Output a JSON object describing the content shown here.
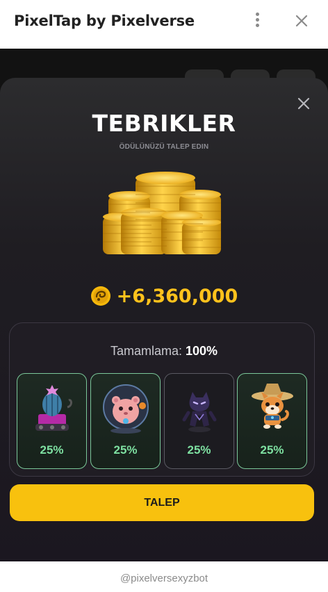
{
  "window": {
    "title": "PixelTap by Pixelverse",
    "icons": [
      "more-vertical-icon",
      "close-icon"
    ]
  },
  "modal": {
    "title": "TEBRIKLER",
    "subtitle": "ÖDÜLÜNÜZÜ TALEP EDIN",
    "reward": {
      "icon": "pixel-coin-icon",
      "amount": "+6,360,000"
    },
    "progress": {
      "label": "Tamamlama:",
      "value": "100%"
    },
    "cards": [
      {
        "name": "cactus-pet",
        "percent": "25%"
      },
      {
        "name": "hamster-pet",
        "percent": "25%"
      },
      {
        "name": "panther-pet",
        "percent": "25%"
      },
      {
        "name": "shiba-pet",
        "percent": "25%"
      }
    ],
    "claim_label": "TALEP"
  },
  "footer": {
    "bot_handle": "@pixelversexyzbot"
  },
  "colors": {
    "accent": "#f8c10e",
    "reward": "#ffc21c",
    "percent": "#7ee0a1",
    "sheet": "#1f1d22"
  }
}
